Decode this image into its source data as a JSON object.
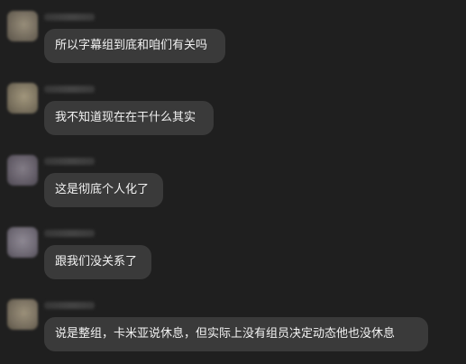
{
  "messages": [
    {
      "text": "所以字幕组到底和咱们有关吗",
      "avatar_color": "#8c8272"
    },
    {
      "text": "我不知道现在在干什么其实",
      "avatar_color": "#938a74"
    },
    {
      "text": "这是彻底个人化了",
      "avatar_color": "#7c7480"
    },
    {
      "text": "跟我们没关系了",
      "avatar_color": "#86808a"
    },
    {
      "text": "说是整组，卡米亚说休息，但实际上没有组员决定动态他也没休息",
      "avatar_color": "#8f8574"
    }
  ]
}
